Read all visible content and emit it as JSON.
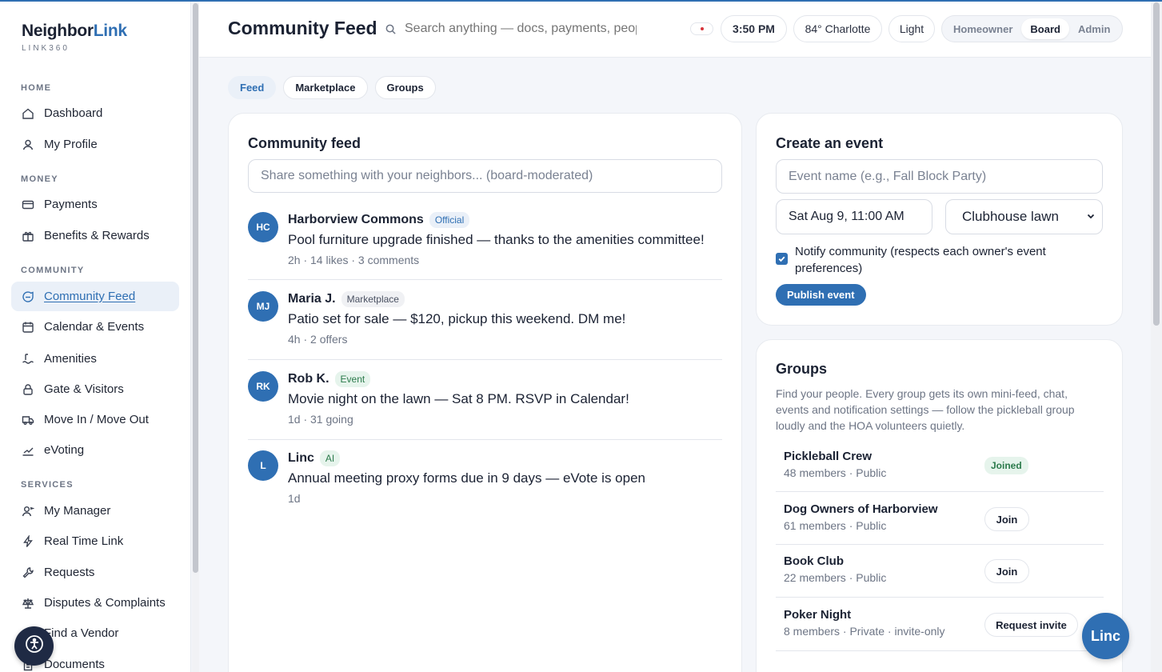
{
  "brand": {
    "name_main": "Neighbor",
    "name_accent": "Link",
    "sub": "LINK360"
  },
  "sidebar": {
    "sections": [
      {
        "label": "HOME",
        "items": [
          {
            "label": "Dashboard",
            "icon": "home-icon"
          },
          {
            "label": "My Profile",
            "icon": "user-icon"
          }
        ]
      },
      {
        "label": "MONEY",
        "items": [
          {
            "label": "Payments",
            "icon": "card-icon"
          },
          {
            "label": "Benefits & Rewards",
            "icon": "gift-icon"
          }
        ]
      },
      {
        "label": "COMMUNITY",
        "items": [
          {
            "label": "Community Feed",
            "icon": "chat-icon",
            "active": true
          },
          {
            "label": "Calendar & Events",
            "icon": "calendar-icon"
          },
          {
            "label": "Amenities",
            "icon": "pool-icon"
          },
          {
            "label": "Gate & Visitors",
            "icon": "lock-icon"
          },
          {
            "label": "Move In / Move Out",
            "icon": "truck-icon"
          },
          {
            "label": "eVoting",
            "icon": "ballot-icon"
          }
        ]
      },
      {
        "label": "SERVICES",
        "items": [
          {
            "label": "My Manager",
            "icon": "manager-icon"
          },
          {
            "label": "Real Time Link",
            "icon": "lightning-icon"
          },
          {
            "label": "Requests",
            "icon": "wrench-icon"
          },
          {
            "label": "Disputes & Complaints",
            "icon": "scales-icon"
          },
          {
            "label": "Find a Vendor",
            "icon": "search-icon"
          },
          {
            "label": "Documents",
            "icon": "document-icon"
          }
        ]
      }
    ]
  },
  "header": {
    "title": "Community Feed",
    "search_placeholder": "Search anything — docs, payments, people...",
    "time": "3:50 PM",
    "weather": "84° Charlotte",
    "theme": "Light",
    "roles": [
      "Homeowner",
      "Board",
      "Admin"
    ],
    "active_role": "Board"
  },
  "tabs": [
    {
      "label": "Feed",
      "active": true
    },
    {
      "label": "Marketplace"
    },
    {
      "label": "Groups"
    }
  ],
  "feed": {
    "title": "Community feed",
    "composer_placeholder": "Share something with your neighbors... (board-moderated)",
    "posts": [
      {
        "initials": "HC",
        "author": "Harborview Commons",
        "badge": "Official",
        "badge_type": "official",
        "text": "Pool furniture upgrade finished — thanks to the amenities committee!",
        "meta": "2h · 14 likes · 3 comments"
      },
      {
        "initials": "MJ",
        "author": "Maria J.",
        "badge": "Marketplace",
        "badge_type": "marketplace",
        "text": "Patio set for sale — $120, pickup this weekend. DM me!",
        "meta": "4h · 2 offers"
      },
      {
        "initials": "RK",
        "author": "Rob K.",
        "badge": "Event",
        "badge_type": "event",
        "text": "Movie night on the lawn — Sat 8 PM. RSVP in Calendar!",
        "meta": "1d · 31 going"
      },
      {
        "initials": "L",
        "author": "Linc",
        "badge": "AI",
        "badge_type": "ai",
        "text": "Annual meeting proxy forms due in 9 days — eVote is open",
        "meta": "1d"
      }
    ]
  },
  "event_form": {
    "title": "Create an event",
    "name_placeholder": "Event name (e.g., Fall Block Party)",
    "date_value": "Sat Aug 9, 11:00 AM",
    "location_value": "Clubhouse lawn",
    "notify_checked": true,
    "notify_label": "Notify community (respects each owner's event preferences)",
    "publish_label": "Publish event"
  },
  "groups": {
    "title": "Groups",
    "description": "Find your people. Every group gets its own mini-feed, chat, events and notification settings — follow the pickleball group loudly and the HOA volunteers quietly.",
    "items": [
      {
        "name": "Pickleball Crew",
        "meta": "48 members · Public",
        "status": "Joined"
      },
      {
        "name": "Dog Owners of Harborview",
        "meta": "61 members · Public",
        "action": "Join"
      },
      {
        "name": "Book Club",
        "meta": "22 members · Public",
        "action": "Join"
      },
      {
        "name": "Poker Night",
        "meta": "8 members · Private · invite-only",
        "action": "Request invite"
      }
    ]
  },
  "fab": {
    "linc_label": "Linc",
    "accessibility_icon": "accessibility-icon"
  },
  "colors": {
    "accent": "#2f6fb3",
    "navy": "#1f2a44",
    "success": "#2b7a4b"
  }
}
